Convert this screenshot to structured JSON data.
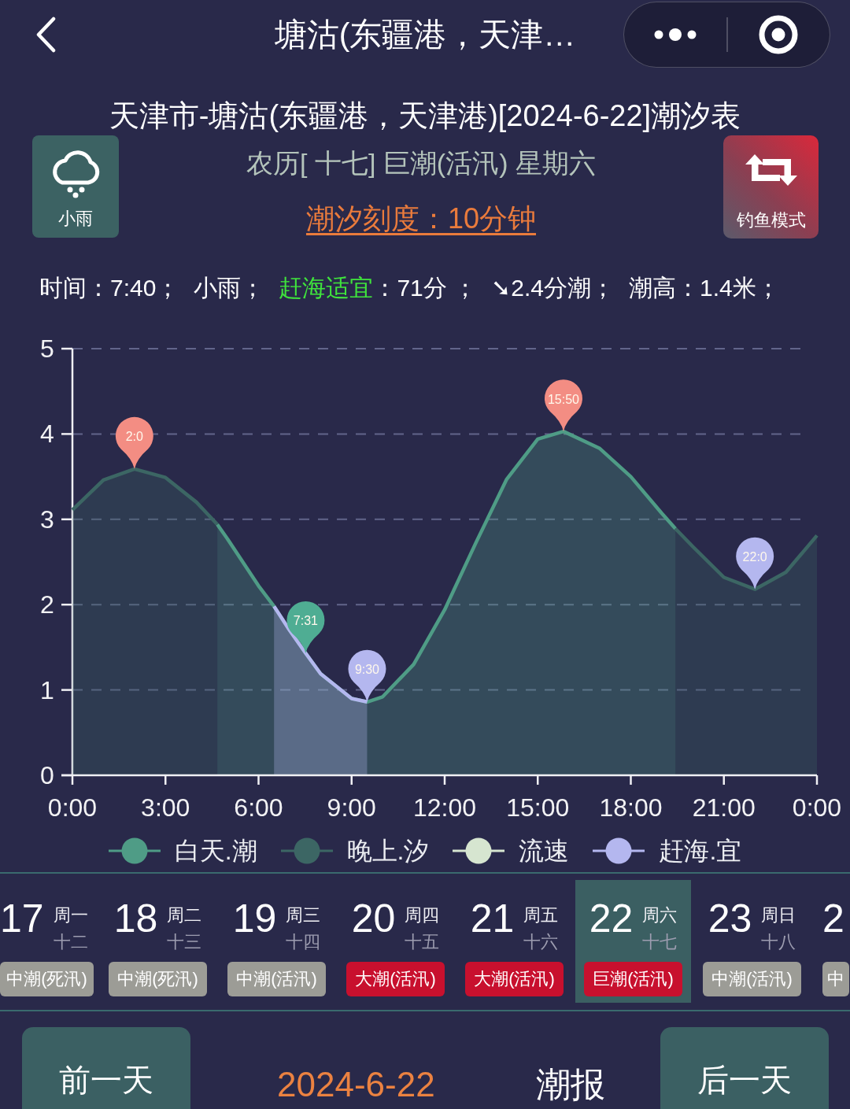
{
  "nav": {
    "title": "塘沽(东疆港，天津…"
  },
  "header": {
    "title": "天津市-塘沽(东疆港，天津港)[2024-6-22]潮汐表",
    "subtitle": "农历[ 十七] 巨潮(活汛) 星期六",
    "scale_link": "潮汐刻度：10分钟",
    "weather": {
      "label": "小雨"
    },
    "mode_button": {
      "label": "钓鱼模式"
    }
  },
  "info": [
    {
      "text": "时间：7:40；"
    },
    {
      "text": "小雨；"
    },
    {
      "highlight": "赶海适宜",
      "text": "：71分 ；"
    },
    {
      "text": "➘2.4分潮；"
    },
    {
      "text": "潮高：1.4米；"
    }
  ],
  "chart": {
    "chart_data": {
      "type": "area",
      "grid": true,
      "xlim": [
        0,
        24
      ],
      "ylim": [
        0,
        5
      ],
      "x": [
        0,
        1,
        2,
        3,
        4,
        4.67,
        5,
        6,
        6.5,
        7,
        7.52,
        8,
        9,
        9.5,
        10,
        11,
        12,
        13,
        14,
        15,
        15.83,
        17,
        18,
        19,
        19.44,
        20,
        21,
        22,
        23,
        24
      ],
      "xticks": [
        {
          "value": 0,
          "label": "0:00"
        },
        {
          "value": 3,
          "label": "3:00"
        },
        {
          "value": 6,
          "label": "6:00"
        },
        {
          "value": 9,
          "label": "9:00"
        },
        {
          "value": 12,
          "label": "12:00"
        },
        {
          "value": 15,
          "label": "15:00"
        },
        {
          "value": 18,
          "label": "18:00"
        },
        {
          "value": 21,
          "label": "21:00"
        },
        {
          "value": 24,
          "label": "0:00"
        }
      ],
      "yticks": [
        0,
        1,
        2,
        3,
        4,
        5
      ],
      "series": [
        {
          "name": "白天.潮",
          "color": "#4f9c86",
          "values": [
            null,
            null,
            null,
            null,
            null,
            2.94,
            2.77,
            2.22,
            1.98,
            1.7,
            1.43,
            1.19,
            0.9,
            0.86,
            0.92,
            1.3,
            1.94,
            2.72,
            3.47,
            3.94,
            4.03,
            3.83,
            3.5,
            3.07,
            2.89,
            null,
            null,
            null,
            null,
            null
          ]
        },
        {
          "name": "晚上.汐",
          "color": "#3c6664",
          "values": [
            3.11,
            3.46,
            3.59,
            3.49,
            3.2,
            2.94,
            null,
            null,
            null,
            null,
            null,
            null,
            null,
            null,
            null,
            null,
            null,
            null,
            null,
            null,
            null,
            null,
            null,
            null,
            2.89,
            2.68,
            2.32,
            2.18,
            2.38,
            2.81
          ]
        },
        {
          "name": "流速",
          "color": "#d6e5d0",
          "values": [
            null,
            null,
            null,
            null,
            null,
            null,
            null,
            null,
            null,
            null,
            null,
            null,
            null,
            null,
            null,
            null,
            null,
            null,
            null,
            null,
            null,
            null,
            null,
            null,
            null,
            null,
            null,
            null,
            null,
            null
          ]
        },
        {
          "name": "赶海.宜",
          "color": "#b4b7ef",
          "values": [
            null,
            null,
            null,
            null,
            null,
            null,
            null,
            null,
            1.98,
            1.7,
            1.43,
            1.19,
            0.9,
            0.86,
            null,
            null,
            null,
            null,
            null,
            null,
            null,
            null,
            null,
            null,
            null,
            null,
            null,
            null,
            null,
            null
          ]
        }
      ],
      "annotations": [
        {
          "x": 2,
          "y": 3.59,
          "text": "2:0"
        },
        {
          "x": 7.52,
          "y": 1.43,
          "text": "7:31"
        },
        {
          "x": 9.5,
          "y": 0.86,
          "text": "9:30"
        },
        {
          "x": 15.83,
          "y": 4.03,
          "text": "15:50"
        },
        {
          "x": 22,
          "y": 2.18,
          "text": "22:0"
        }
      ]
    },
    "pins": [
      {
        "color": "#f38d83"
      },
      {
        "color": "#4fad93"
      },
      {
        "color": "#b4b7ef"
      },
      {
        "color": "#f38d83"
      },
      {
        "color": "#b4b7ef"
      }
    ]
  },
  "days": [
    {
      "day": "17",
      "weekday": "周一",
      "lunar": "十二",
      "tide": "中潮(死汛)",
      "color": "#9c9c96",
      "selected": false
    },
    {
      "day": "18",
      "weekday": "周二",
      "lunar": "十三",
      "tide": "中潮(死汛)",
      "color": "#9c9c96",
      "selected": false
    },
    {
      "day": "19",
      "weekday": "周三",
      "lunar": "十四",
      "tide": "中潮(活汛)",
      "color": "#9c9c96",
      "selected": false
    },
    {
      "day": "20",
      "weekday": "周四",
      "lunar": "十五",
      "tide": "大潮(活汛)",
      "color": "#c8102e",
      "selected": false
    },
    {
      "day": "21",
      "weekday": "周五",
      "lunar": "十六",
      "tide": "大潮(活汛)",
      "color": "#c8102e",
      "selected": false
    },
    {
      "day": "22",
      "weekday": "周六",
      "lunar": "十七",
      "tide": "巨潮(活汛)",
      "color": "#c8102e",
      "selected": true
    },
    {
      "day": "23",
      "weekday": "周日",
      "lunar": "十八",
      "tide": "中潮(活汛)",
      "color": "#9c9c96",
      "selected": false
    },
    {
      "day": "2",
      "tide": "中",
      "color": "#9c9c96",
      "selected": false
    }
  ],
  "footer": {
    "prev_button": "前一天",
    "date": "2024-6-22",
    "report": "潮报",
    "next_button": "后一天"
  }
}
